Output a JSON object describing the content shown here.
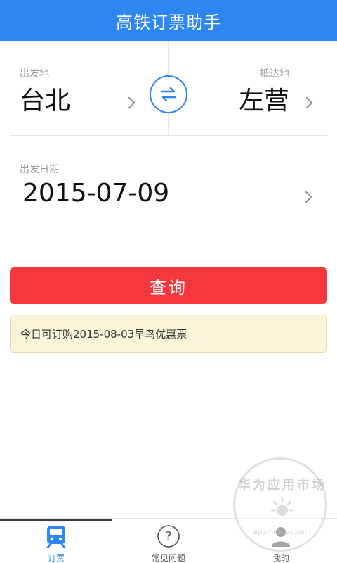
{
  "header": {
    "title": "高铁订票助手"
  },
  "from": {
    "label": "出发地",
    "station": "台北"
  },
  "to": {
    "label": "抵达地",
    "station": "左营"
  },
  "date": {
    "label": "出发日期",
    "value": "2015-07-09"
  },
  "search_button": {
    "label": "查询"
  },
  "notice": {
    "text": "今日可订购2015-08-03早鸟优惠票"
  },
  "tabs": [
    {
      "label": "订票",
      "icon": "train-icon",
      "active": true
    },
    {
      "label": "常见问题",
      "icon": "question-icon",
      "active": false
    },
    {
      "label": "我的",
      "icon": "user-icon",
      "active": false
    }
  ],
  "watermark": {
    "text": "华为应用市场",
    "url": "app.hicloud.com"
  },
  "colors": {
    "header": "#2e86f0",
    "accent": "#2e86f0",
    "search_button": "#f5383e",
    "notice_bg": "#faf5d8"
  }
}
